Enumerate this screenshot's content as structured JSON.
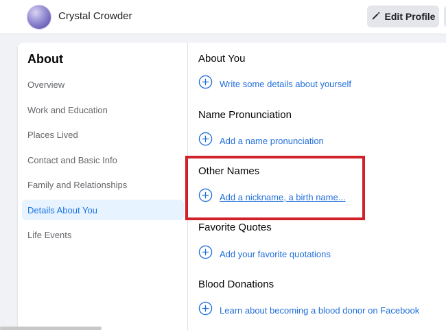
{
  "header": {
    "profile_name": "Crystal Crowder",
    "edit_profile_label": "Edit Profile"
  },
  "sidebar": {
    "title": "About",
    "items": [
      {
        "label": "Overview",
        "active": false
      },
      {
        "label": "Work and Education",
        "active": false
      },
      {
        "label": "Places Lived",
        "active": false
      },
      {
        "label": "Contact and Basic Info",
        "active": false
      },
      {
        "label": "Family and Relationships",
        "active": false
      },
      {
        "label": "Details About You",
        "active": true
      },
      {
        "label": "Life Events",
        "active": false
      }
    ]
  },
  "sections": [
    {
      "title": "About You",
      "action": "Write some details about yourself"
    },
    {
      "title": "Name Pronunciation",
      "action": "Add a name pronunciation"
    },
    {
      "title": "Other Names",
      "action": "Add a nickname, a birth name..."
    },
    {
      "title": "Favorite Quotes",
      "action": "Add your favorite quotations"
    },
    {
      "title": "Blood Donations",
      "action": "Learn about becoming a blood donor on Facebook"
    }
  ],
  "colors": {
    "link": "#216fdb",
    "active_bg": "#e7f3ff",
    "highlight": "#d0202a"
  },
  "icons": {
    "edit": "pencil-icon",
    "add": "plus-circle-icon"
  }
}
